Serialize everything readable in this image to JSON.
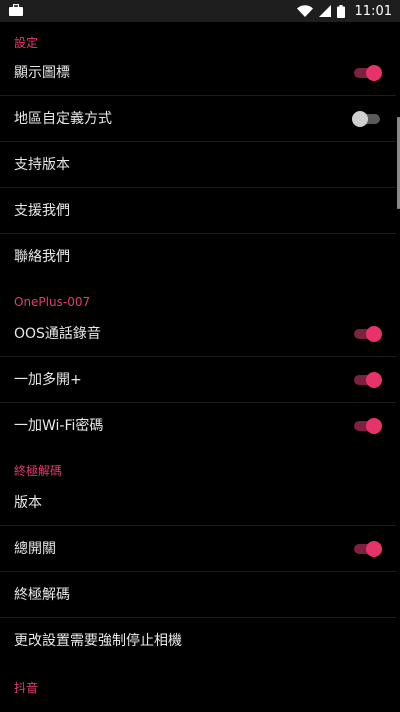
{
  "status_bar": {
    "time": "11:01",
    "icons": [
      "briefcase-icon",
      "wifi-icon",
      "signal-icon",
      "battery-icon"
    ]
  },
  "colors": {
    "accent": "#e8336a",
    "section_header": "#e23c6e",
    "background": "#000000"
  },
  "sections": [
    {
      "title": "設定",
      "items": [
        {
          "label": "顯示圖標",
          "toggle": "on"
        },
        {
          "label": "地區自定義方式",
          "toggle": "off"
        },
        {
          "label": "支持版本"
        },
        {
          "label": "支援我們"
        },
        {
          "label": "聯絡我們"
        }
      ]
    },
    {
      "title": "OnePlus-007",
      "items": [
        {
          "label": "OOS通話錄音",
          "toggle": "on"
        },
        {
          "label": "一加多開+",
          "toggle": "on"
        },
        {
          "label": "一加Wi-Fi密碼",
          "toggle": "on"
        }
      ]
    },
    {
      "title": "終極解碼",
      "items": [
        {
          "label": "版本"
        },
        {
          "label": "總開關",
          "toggle": "on"
        },
        {
          "label": "終極解碼"
        },
        {
          "label": "更改設置需要強制停止相機"
        }
      ]
    },
    {
      "title": "抖音",
      "items": []
    }
  ]
}
